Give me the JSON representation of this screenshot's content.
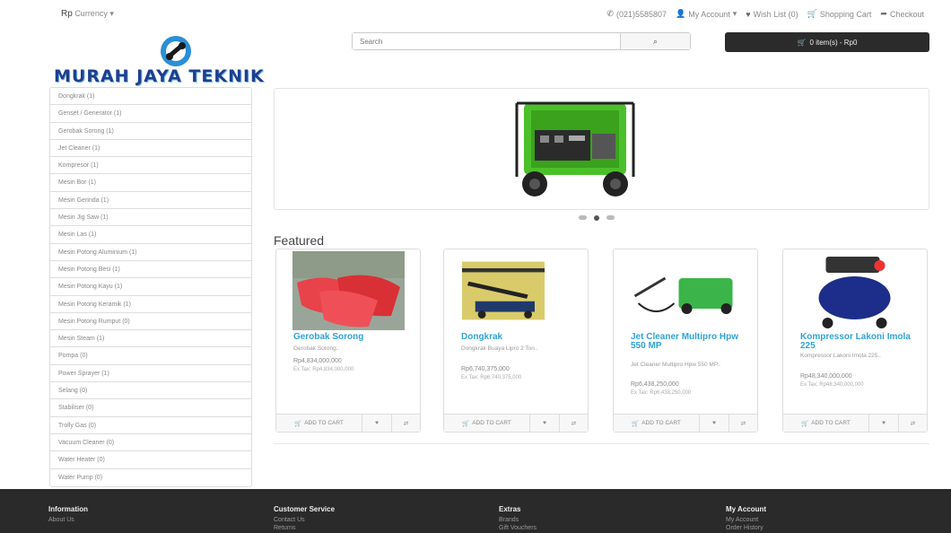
{
  "topbar": {
    "currency_symbol": "Rp",
    "currency_label": "Currency",
    "phone": "(021)5585807",
    "my_account": "My Account",
    "wish_list": "Wish List (0)",
    "shopping_cart": "Shopping Cart",
    "checkout": "Checkout"
  },
  "logo": {
    "text": "MURAH JAYA TEKNIK"
  },
  "search": {
    "placeholder": "Search"
  },
  "cart": {
    "label": "0 item(s) - Rp0"
  },
  "sidebar": {
    "items": [
      "Dongkrak (1)",
      "Genset / Generator (1)",
      "Gerobak Sorong (1)",
      "Jet Cleaner (1)",
      "Kompresor (1)",
      "Mesin Bor (1)",
      "Mesin Gerinda (1)",
      "Mesin Jig Saw (1)",
      "Mesin Las (1)",
      "Mesin Potong Aluminium (1)",
      "Mesin Potong Besi (1)",
      "Mesin Potong Kayu (1)",
      "Mesin Potong Keramik (1)",
      "Mesin Potong Rumput (0)",
      "Mesin Steam (1)",
      "Pompa (0)",
      "Power Sprayer (1)",
      "Selang (0)",
      "Stabiliser (0)",
      "Trolly Gas (0)",
      "Vacuum Cleaner (0)",
      "Water Heater (0)",
      "Water Pump (0)"
    ]
  },
  "featured": {
    "title": "Featured",
    "add_to_cart": "ADD TO CART",
    "products": [
      {
        "name": "Gerobak Sorong",
        "desc": "Gerobak Sorong..",
        "price": "Rp4,834,000,000",
        "extax": "Ex Tax: Rp4,834,000,000"
      },
      {
        "name": "Dongkrak",
        "desc": "Dongkrak Buaya Lipro 2 Ton..",
        "price": "Rp6,740,375,000",
        "extax": "Ex Tax: Rp6,740,375,000"
      },
      {
        "name": "Jet Cleaner Multipro Hpw 550 MP",
        "desc": "Jet Cleaner Multipro Hpw 550 MP..",
        "price": "Rp6,438,250,000",
        "extax": "Ex Tax: Rp6,438,250,000"
      },
      {
        "name": "Kompressor Lakoni Imola 225",
        "desc": "Kompressor Lakoni Imola 225..",
        "price": "Rp48,340,000,000",
        "extax": "Ex Tax: Rp48,340,000,000"
      }
    ]
  },
  "footer": {
    "information": {
      "title": "Information",
      "links": [
        "About Us"
      ]
    },
    "customer_service": {
      "title": "Customer Service",
      "links": [
        "Contact Us",
        "Returns"
      ]
    },
    "extras": {
      "title": "Extras",
      "links": [
        "Brands",
        "Gift Vouchers"
      ]
    },
    "my_account": {
      "title": "My Account",
      "links": [
        "My Account",
        "Order History"
      ]
    }
  }
}
